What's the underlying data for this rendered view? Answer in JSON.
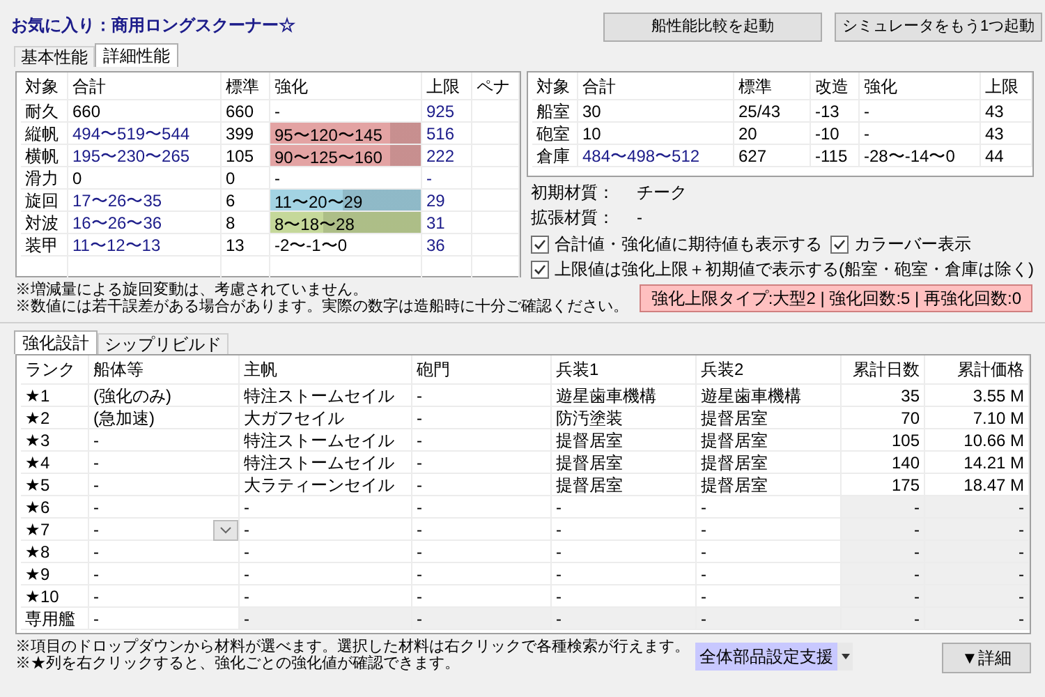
{
  "title": "お気に入り：商用ロングスクーナー☆",
  "buttons": [
    "船性能比較を起動",
    "シミュレータをもう1つ起動"
  ],
  "top_tabs": [
    {
      "label": "基本性能",
      "selected": false
    },
    {
      "label": "詳細性能",
      "selected": true
    }
  ],
  "stats_table": {
    "columns": [
      "対象",
      "合計",
      "標準",
      "強化",
      "上限",
      "ペナ"
    ],
    "rows": [
      {
        "name": "耐久",
        "total": "660",
        "expected": false,
        "base": "660",
        "enh": "-",
        "limit_text": "925"
      },
      {
        "name": "縦帆",
        "total": "494〜519〜544",
        "expected": true,
        "base": "399",
        "enh": "95〜120〜145",
        "bar": {
          "color": "#e3a3a3",
          "level": 0.8
        },
        "limit_text": "516"
      },
      {
        "name": "横帆",
        "total": "195〜230〜265",
        "expected": true,
        "base": "105",
        "enh": "90〜125〜160",
        "bar": {
          "color": "#e3a3a3",
          "level": 0.8
        },
        "limit_text": "222"
      },
      {
        "name": "滑力",
        "total": "0",
        "expected": false,
        "base": "0",
        "enh": "-",
        "limit_text": "-"
      },
      {
        "name": "旋回",
        "total": "17〜26〜35",
        "expected": true,
        "base": "6",
        "enh": "11〜20〜29",
        "bar": {
          "color": "#a3d3e3",
          "level": 0.48
        },
        "limit_text": "29"
      },
      {
        "name": "対波",
        "total": "16〜26〜36",
        "expected": true,
        "base": "8",
        "enh": "8〜18〜28",
        "bar": {
          "color": "#c5d89a",
          "level": 0.35
        },
        "limit_text": "31"
      },
      {
        "name": "装甲",
        "total": "11〜12〜13",
        "expected": true,
        "base": "13",
        "enh": "-2〜-1〜0",
        "limit_text": "36"
      }
    ]
  },
  "notes_top": [
    "※増減量による旋回変動は、考慮されていません。",
    "※数値には若干誤差がある場合があります。実際の数字は造船時に十分ご確認ください。"
  ],
  "room_table": {
    "columns": [
      "対象",
      "合計",
      "標準",
      "改造",
      "強化",
      "上限"
    ],
    "rows": [
      {
        "name": "船室",
        "total": "30",
        "expected": false,
        "base": "25/43",
        "mod": "-13",
        "enh": "-",
        "limit": "43"
      },
      {
        "name": "砲室",
        "total": "10",
        "expected": false,
        "base": "20",
        "mod": "-10",
        "enh": "-",
        "limit": "43"
      },
      {
        "name": "倉庫",
        "total": "484〜498〜512",
        "expected": true,
        "base": "627",
        "mod": "-115",
        "enh": "-28〜-14〜0",
        "limit": "44"
      }
    ]
  },
  "materials": [
    {
      "label": "初期材質：",
      "value": "チーク"
    },
    {
      "label": "拡張材質：",
      "value": "-"
    }
  ],
  "checkboxes": [
    {
      "label": "合計値・強化値に期待値も表示する",
      "checked": true
    },
    {
      "label": "カラーバー表示",
      "checked": true
    },
    {
      "label": "上限値は強化上限＋初期値で表示する(船室・砲室・倉庫は除く)",
      "checked": true
    }
  ],
  "limit_badge": "強化上限タイプ:大型2 | 強化回数:5 | 再強化回数:0",
  "bottom_tabs": [
    {
      "label": "強化設計",
      "selected": true
    },
    {
      "label": "シップリビルド",
      "selected": false
    }
  ],
  "design_table": {
    "columns": [
      "ランク",
      "船体等",
      "主帆",
      "砲門",
      "兵装1",
      "兵装2",
      "累計日数",
      "累計価格"
    ],
    "rows": [
      {
        "kind": "star",
        "reached": true,
        "dropdown": false,
        "cells": [
          "★1",
          "(強化のみ)",
          "特注ストームセイル",
          "-",
          "遊星歯車機構",
          "遊星歯車機構",
          "35",
          "3.55 M"
        ]
      },
      {
        "kind": "star",
        "reached": true,
        "dropdown": false,
        "cells": [
          "★2",
          "(急加速)",
          "大ガフセイル",
          "-",
          "防汚塗装",
          "提督居室",
          "70",
          "7.10 M"
        ]
      },
      {
        "kind": "star",
        "reached": true,
        "dropdown": false,
        "cells": [
          "★3",
          "-",
          "特注ストームセイル",
          "-",
          "提督居室",
          "提督居室",
          "105",
          "10.66 M"
        ]
      },
      {
        "kind": "star",
        "reached": true,
        "dropdown": false,
        "cells": [
          "★4",
          "-",
          "特注ストームセイル",
          "-",
          "提督居室",
          "提督居室",
          "140",
          "14.21 M"
        ]
      },
      {
        "kind": "star",
        "reached": true,
        "dropdown": false,
        "cells": [
          "★5",
          "-",
          "大ラティーンセイル",
          "-",
          "提督居室",
          "提督居室",
          "175",
          "18.47 M"
        ]
      },
      {
        "kind": "star",
        "reached": false,
        "dropdown": false,
        "cells": [
          "★6",
          "-",
          "-",
          "-",
          "-",
          "-",
          "-",
          "-"
        ]
      },
      {
        "kind": "star",
        "reached": false,
        "dropdown": true,
        "cells": [
          "★7",
          "-",
          "-",
          "-",
          "-",
          "-",
          "-",
          "-"
        ]
      },
      {
        "kind": "star",
        "reached": false,
        "dropdown": false,
        "cells": [
          "★8",
          "-",
          "-",
          "-",
          "-",
          "-",
          "-",
          "-"
        ]
      },
      {
        "kind": "star",
        "reached": false,
        "dropdown": false,
        "cells": [
          "★9",
          "-",
          "-",
          "-",
          "-",
          "-",
          "-",
          "-"
        ]
      },
      {
        "kind": "star",
        "reached": false,
        "dropdown": false,
        "cells": [
          "★10",
          "-",
          "-",
          "-",
          "-",
          "-",
          "-",
          "-"
        ]
      },
      {
        "kind": "special",
        "dropdown": false,
        "cells": [
          "専用艦",
          "-",
          "-",
          "-",
          "-",
          "-",
          "-",
          "-"
        ]
      }
    ]
  },
  "notes_bottom": [
    "※項目のドロップダウンから材料が選べます。選択した材料は右クリックで各種検索が行えます。",
    "※★列を右クリックすると、強化ごとの強化値が確認できます。"
  ],
  "support_menu": "全体部品設定支援",
  "detail_button": "▼詳細"
}
